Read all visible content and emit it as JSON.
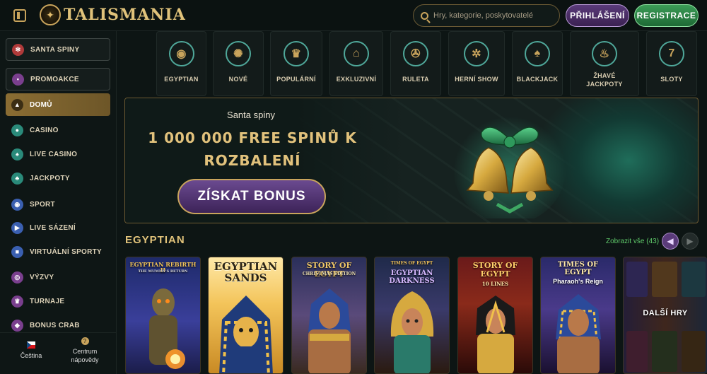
{
  "header": {
    "logo_text": "TALISMANIA",
    "search_placeholder": "Hry, kategorie, poskytovatelé",
    "login_label": "PŘIHLÁŠENÍ",
    "register_label": "REGISTRACE"
  },
  "sidebar": {
    "items": [
      {
        "label": "SANTA SPINY",
        "icon": "snowflake-icon"
      },
      {
        "label": "PROMOAKCE",
        "icon": "gift-icon"
      },
      {
        "label": "DOMŮ",
        "icon": "pyramid-icon"
      },
      {
        "label": "CASINO",
        "icon": "casino-chip-icon"
      },
      {
        "label": "LIVE CASINO",
        "icon": "spade-icon"
      },
      {
        "label": "JACKPOTY",
        "icon": "clover-icon"
      },
      {
        "label": "SPORT",
        "icon": "ball-icon"
      },
      {
        "label": "LIVE SÁZENÍ",
        "icon": "play-icon"
      },
      {
        "label": "VIRTUÁLNÍ SPORTY",
        "icon": "gamepad-icon"
      },
      {
        "label": "VÝZVY",
        "icon": "target-icon"
      },
      {
        "label": "TURNAJE",
        "icon": "trophy-icon"
      },
      {
        "label": "BONUS CRAB",
        "icon": "crab-icon"
      }
    ],
    "language_label": "Čeština",
    "help_label": "Centrum nápovědy"
  },
  "categories": [
    {
      "label": "EGYPTIAN",
      "icon": "eye-of-horus-icon"
    },
    {
      "label": "NOVÉ",
      "icon": "star-burst-icon"
    },
    {
      "label": "POPULÁRNÍ",
      "icon": "crown-icon"
    },
    {
      "label": "EXKLUZIVNÍ",
      "icon": "temple-icon"
    },
    {
      "label": "RULETA",
      "icon": "roulette-icon"
    },
    {
      "label": "HERNÍ SHOW",
      "icon": "wheel-icon"
    },
    {
      "label": "BLACKJACK",
      "icon": "spade-card-icon"
    },
    {
      "label": "ŽHAVÉ JACKPOTY",
      "icon": "fire-icon"
    },
    {
      "label": "SLOTY",
      "icon": "slot-machine-icon"
    }
  ],
  "banner": {
    "subtitle": "Santa spiny",
    "title": "1 000 000 FREE SPINŮ K ROZBALENÍ",
    "cta_label": "ZÍSKAT BONUS"
  },
  "section": {
    "title": "EGYPTIAN",
    "view_all_label": "Zobrazit vše (43)"
  },
  "games": [
    {
      "title": "EGYPTIAN REBIRTH II",
      "subtitle": "THE MUMMY'S RETURN"
    },
    {
      "title": "EGYPTIAN SANDS"
    },
    {
      "title": "STORY OF EGYPT",
      "subtitle": "CHRISTMAS EDITION"
    },
    {
      "title": "EGYPTIAN DARKNESS",
      "subtitle": "TIMES OF EGYPT"
    },
    {
      "title": "STORY OF EGYPT",
      "subtitle": "10 LINES"
    },
    {
      "title": "TIMES OF EGYPT",
      "subtitle": "Pharaoh's Reign"
    }
  ],
  "more_games_label": "DALŠÍ HRY"
}
